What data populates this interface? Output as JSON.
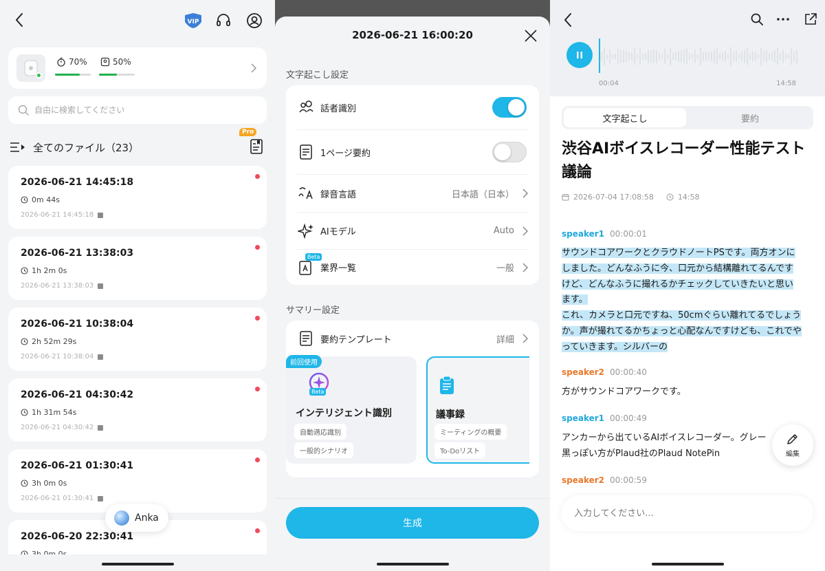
{
  "colors": {
    "accent": "#1fb6e8",
    "speaker1": "#1fa8db",
    "speaker2": "#e9782a",
    "unread": "#ef4a5a",
    "battery": "#21b14b"
  },
  "files_panel": {
    "vip_label": "VIP",
    "device": {
      "battery_case": "70%",
      "battery_device": "50%",
      "battery_case_level": 0.7,
      "battery_device_level": 0.5
    },
    "search_placeholder": "自由に検索してください",
    "list_title": "全てのファイル（23）",
    "pro_badge": "Pro",
    "files": [
      {
        "title": "2026-06-21 14:45:18",
        "duration": "0m 44s",
        "date": "2026-06-21 14:45:18"
      },
      {
        "title": "2026-06-21 13:38:03",
        "duration": "1h 2m 0s",
        "date": "2026-06-21 13:38:03"
      },
      {
        "title": "2026-06-21 10:38:04",
        "duration": "2h 52m 29s",
        "date": "2026-06-21 10:38:04"
      },
      {
        "title": "2026-06-21 04:30:42",
        "duration": "1h 31m 54s",
        "date": "2026-06-21 04:30:42"
      },
      {
        "title": "2026-06-21 01:30:41",
        "duration": "3h 0m 0s",
        "date": "2026-06-21 01:30:41"
      },
      {
        "title": "2026-06-20 22:30:41",
        "duration": "3h 0m 0s",
        "date": ""
      }
    ],
    "assistant_label": "Anka"
  },
  "settings_panel": {
    "title": "2026-06-21 16:00:20",
    "transcription_section": "文字起こし設定",
    "rows": {
      "speaker_id": {
        "label": "話者識別",
        "enabled": true
      },
      "one_page_summary": {
        "label": "1ページ要約",
        "enabled": false
      },
      "language": {
        "label": "録音言語",
        "value": "日本語（日本）"
      },
      "ai_model": {
        "label": "AIモデル",
        "value": "Auto"
      },
      "industry": {
        "label": "業界一覧",
        "value": "一般",
        "beta": "Beta"
      }
    },
    "summary_section": "サマリー設定",
    "template_row": {
      "label": "要約テンプレート",
      "value": "詳細"
    },
    "templates": [
      {
        "badge": "前回使用",
        "icon_beta": "Beta",
        "title": "インテリジェント識別",
        "chips": [
          "自動適応識別",
          "一般的シナリオ"
        ]
      },
      {
        "title": "議事録",
        "chips": [
          "ミーティングの概要",
          "To-Doリスト"
        ]
      }
    ],
    "generate_button": "生成"
  },
  "transcript_panel": {
    "player": {
      "current_time": "00:04",
      "total_time": "14:58"
    },
    "tabs": [
      "文字起こし",
      "要約"
    ],
    "doc_title": "渋谷AIボイスレコーダー性能テスト議論",
    "meta": {
      "datetime": "2026-07-04 17:08:58",
      "duration": "14:58"
    },
    "segments": [
      {
        "speaker": "speaker1",
        "time": "00:00:01",
        "lines": [
          "サウンドコアワークとクラウドノートPSです。両方オンに",
          "しました。どんなふうに今、口元から結構離れてるんです",
          "けど、どんなふうに撮れるかチェックしていきたいと思い",
          "ます。",
          "これ、カメラと口元ですね、50cmぐらい離れてるでしょう",
          "か。声が撮れてるかちょっと心配なんですけども、これでや",
          "っていきます。シルバーの"
        ]
      },
      {
        "speaker": "speaker2",
        "time": "00:00:40",
        "lines": [
          "方がサウンドコアワークです。"
        ]
      },
      {
        "speaker": "speaker1",
        "time": "00:00:49",
        "lines": [
          "アンカーから出ているAIボイスレコーダー。グレー",
          "黒っぽい方がPlaud社のPlaud NotePin"
        ]
      },
      {
        "speaker": "speaker2",
        "time": "00:00:59",
        "lines": []
      }
    ],
    "edit_label": "編集",
    "input_placeholder": "入力してください..."
  }
}
